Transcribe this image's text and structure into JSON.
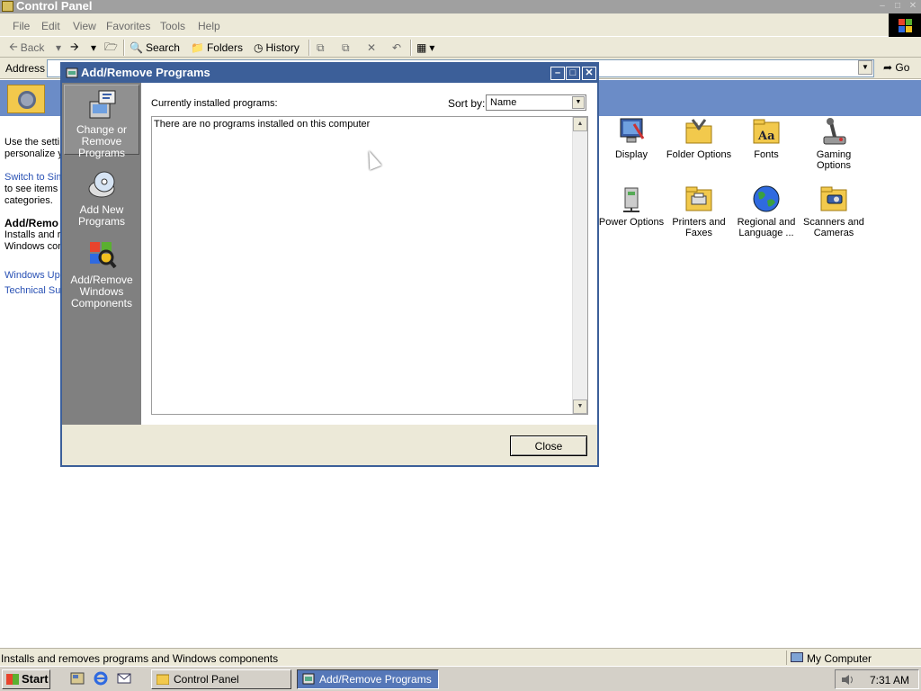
{
  "control_panel": {
    "title": "Control Panel",
    "menu": [
      "File",
      "Edit",
      "View",
      "Favorites",
      "Tools",
      "Help"
    ],
    "toolbar": {
      "back": "Back",
      "search": "Search",
      "folders": "Folders",
      "history": "History"
    },
    "address": {
      "label": "Address",
      "go": "Go"
    },
    "left_pane": {
      "intro_line1": "Use the setti",
      "intro_line2": "personalize y",
      "switch_line1": "Switch to Sim",
      "switch_line2": "to see items",
      "switch_line3": "categories.",
      "selected_title": "Add/Remo",
      "selected_desc1": "Installs and r",
      "selected_desc2": "Windows com",
      "windows_update": "Windows Upd",
      "technical_support": "Technical Sup"
    },
    "icons": [
      {
        "label": "Display",
        "icon": "display-icon"
      },
      {
        "label": "Folder Options",
        "icon": "folder-options-icon"
      },
      {
        "label": "Fonts",
        "icon": "fonts-icon"
      },
      {
        "label": "Gaming Options",
        "icon": "gaming-options-icon"
      },
      {
        "label": "Power Options",
        "icon": "power-options-icon"
      },
      {
        "label": "Printers and Faxes",
        "icon": "printers-icon"
      },
      {
        "label": "Regional and Language ...",
        "icon": "globe-icon"
      },
      {
        "label": "Scanners and Cameras",
        "icon": "scanner-icon"
      }
    ],
    "status": {
      "text": "Installs and removes programs and Windows components",
      "zone": "My Computer"
    }
  },
  "dialog": {
    "title": "Add/Remove Programs",
    "sidebar": [
      {
        "label": "Change or Remove Programs",
        "icon": "change-remove-programs-icon"
      },
      {
        "label": "Add New Programs",
        "icon": "cd-install-icon"
      },
      {
        "label": "Add/Remove Windows Components",
        "icon": "windows-components-icon"
      }
    ],
    "installed_label": "Currently installed programs:",
    "sort_label": "Sort by:",
    "sort_value": "Name",
    "empty_message": "There are no programs installed on this computer",
    "close_button": "Close"
  },
  "taskbar": {
    "start": "Start",
    "tasks": [
      "Control Panel",
      "Add/Remove Programs"
    ],
    "clock": "7:31 AM"
  }
}
